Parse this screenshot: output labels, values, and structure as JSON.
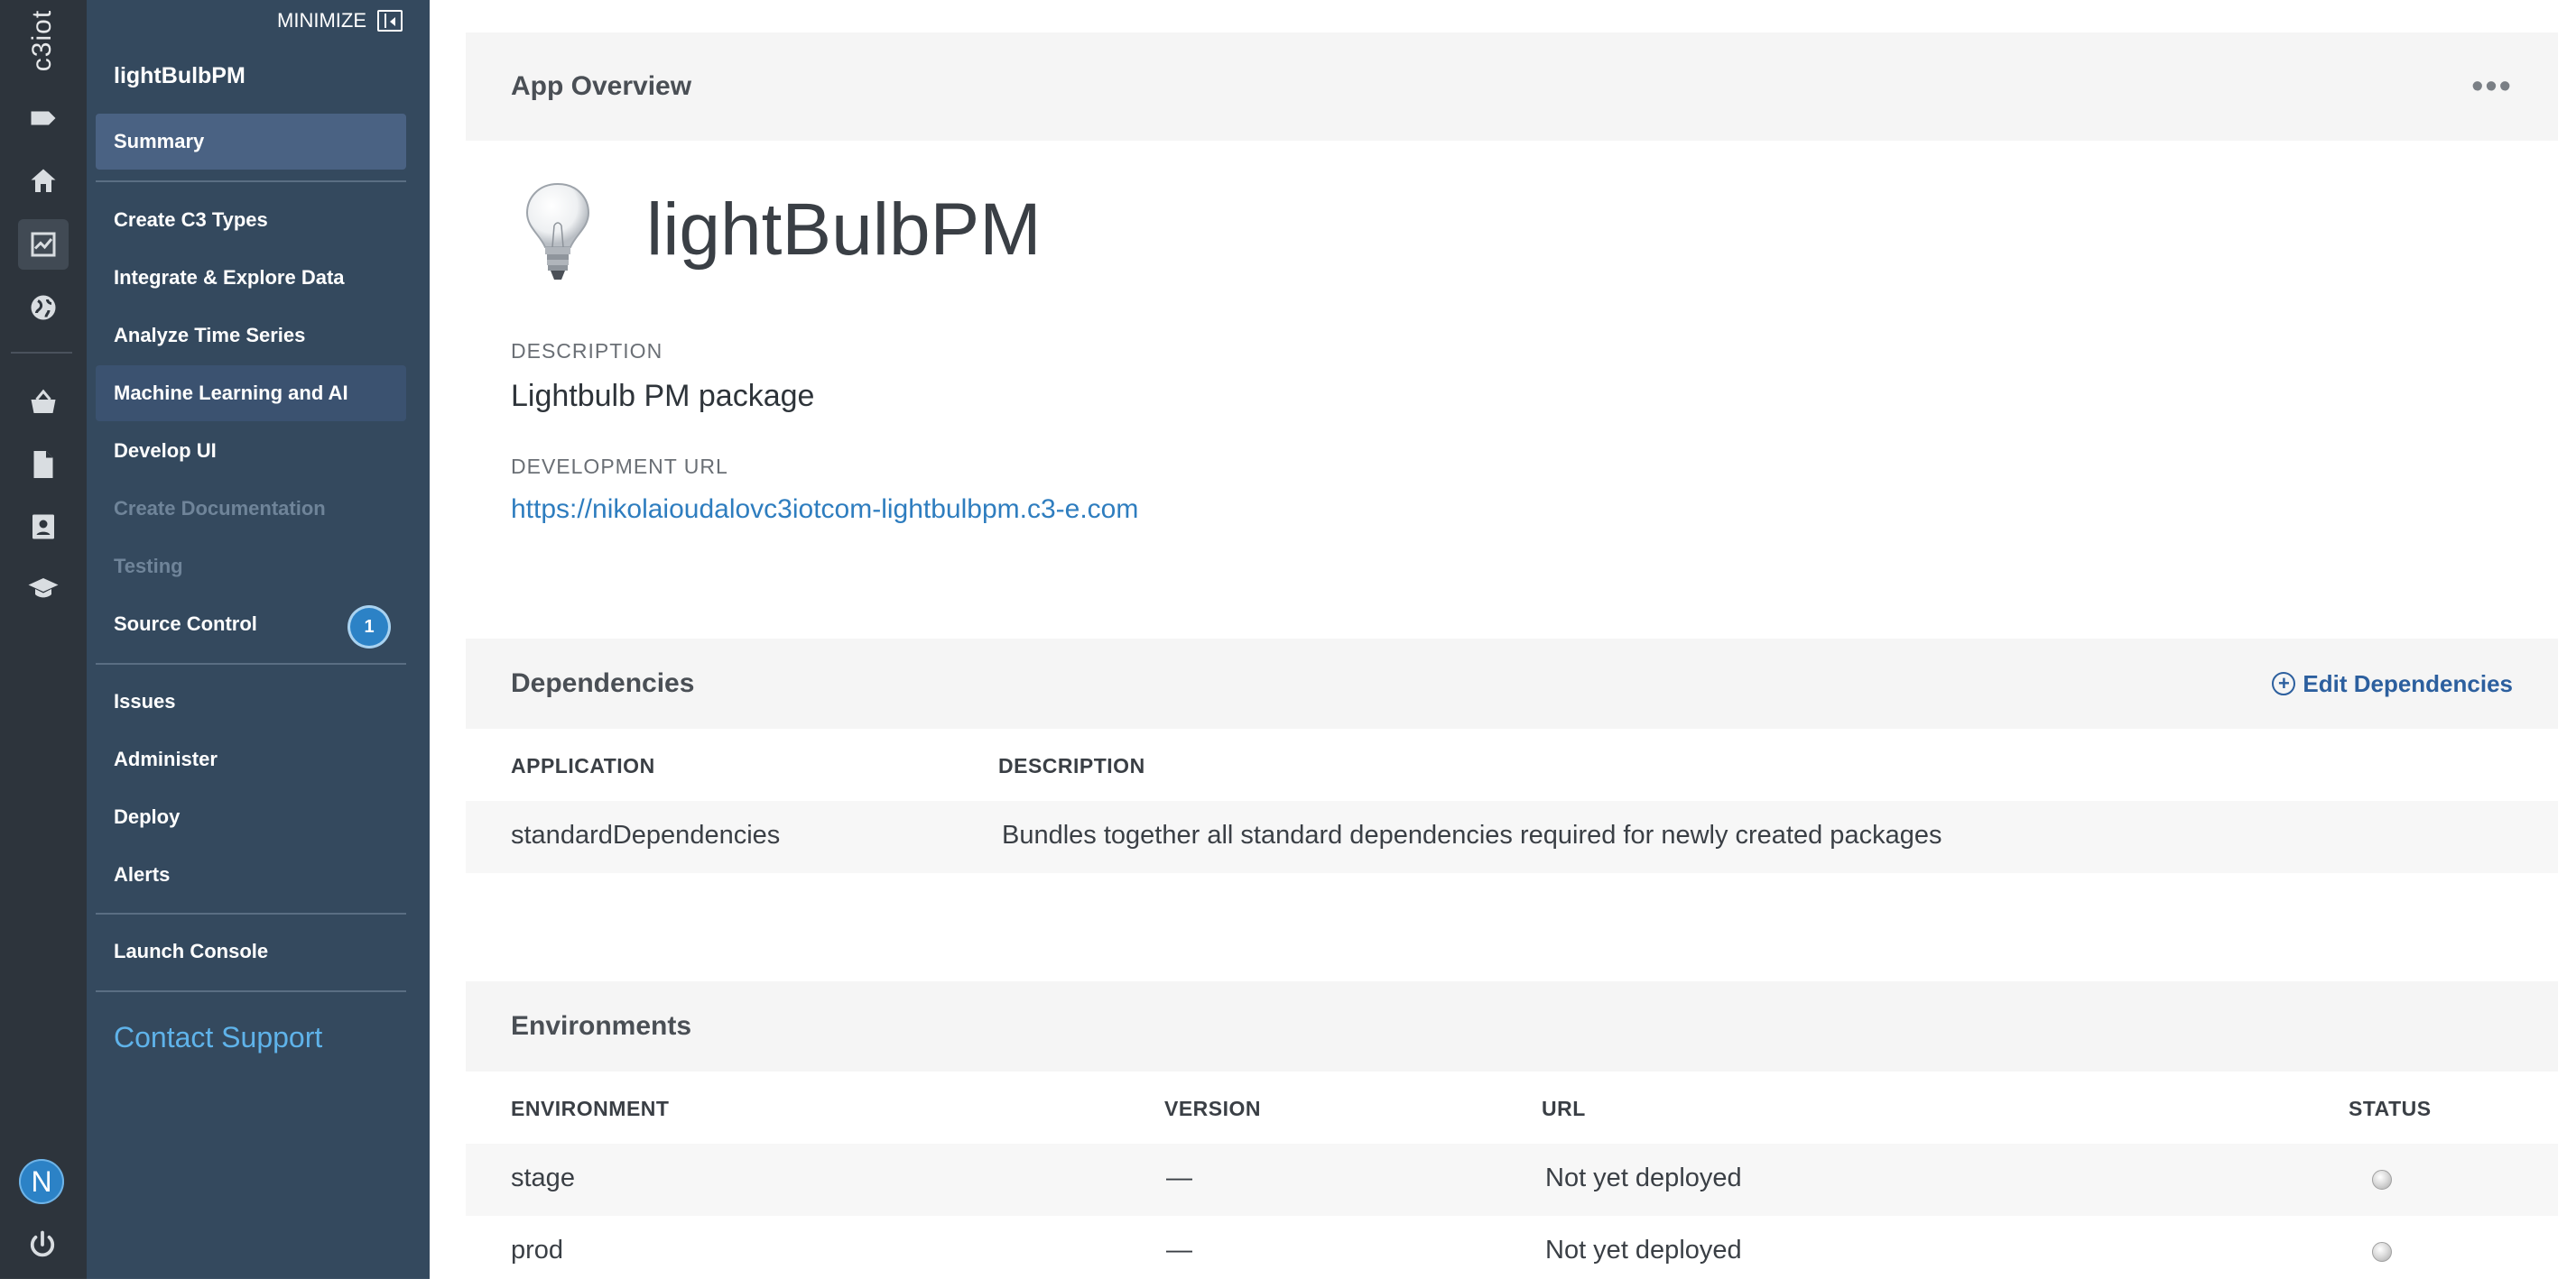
{
  "rail": {
    "logo_text": "c3iot",
    "avatar_initial": "N",
    "icons": [
      "tag-icon",
      "home-icon",
      "analytics-icon",
      "globe-icon",
      "basket-icon",
      "document-icon",
      "contact-card-icon",
      "graduation-cap-icon"
    ]
  },
  "sidebar": {
    "minimize_label": "MINIMIZE",
    "project_name": "lightBulbPM",
    "items": [
      {
        "label": "Summary"
      },
      {
        "label": "Create C3 Types"
      },
      {
        "label": "Integrate & Explore Data"
      },
      {
        "label": "Analyze Time Series"
      },
      {
        "label": "Machine Learning and AI"
      },
      {
        "label": "Develop UI"
      },
      {
        "label": "Create Documentation"
      },
      {
        "label": "Testing"
      },
      {
        "label": "Source Control",
        "badge": "1"
      },
      {
        "label": "Issues"
      },
      {
        "label": "Administer"
      },
      {
        "label": "Deploy"
      },
      {
        "label": "Alerts"
      },
      {
        "label": "Launch Console"
      }
    ],
    "contact_support": "Contact Support"
  },
  "overview": {
    "header": "App Overview",
    "more_label": "•••",
    "app_name": "lightBulbPM",
    "description_label": "DESCRIPTION",
    "description": "Lightbulb PM package",
    "dev_url_label": "DEVELOPMENT URL",
    "dev_url": "https://nikolaioudalovc3iotcom-lightbulbpm.c3-e.com"
  },
  "dependencies": {
    "header": "Dependencies",
    "edit_label": "Edit Dependencies",
    "columns": [
      "APPLICATION",
      "DESCRIPTION"
    ],
    "rows": [
      {
        "application": "standardDependencies",
        "description": "Bundles together all standard dependencies required for newly created packages"
      }
    ]
  },
  "environments": {
    "header": "Environments",
    "columns": [
      "ENVIRONMENT",
      "VERSION",
      "URL",
      "STATUS"
    ],
    "rows": [
      {
        "environment": "stage",
        "version": "—",
        "url": "Not yet deployed"
      },
      {
        "environment": "prod",
        "version": "—",
        "url": "Not yet deployed"
      }
    ]
  },
  "colors": {
    "rail_bg": "#2d343c",
    "sidebar_bg": "#34495e",
    "selected_item": "#4a6283",
    "accent_blue": "#2c82c6",
    "link_blue": "#2e7dbf"
  }
}
